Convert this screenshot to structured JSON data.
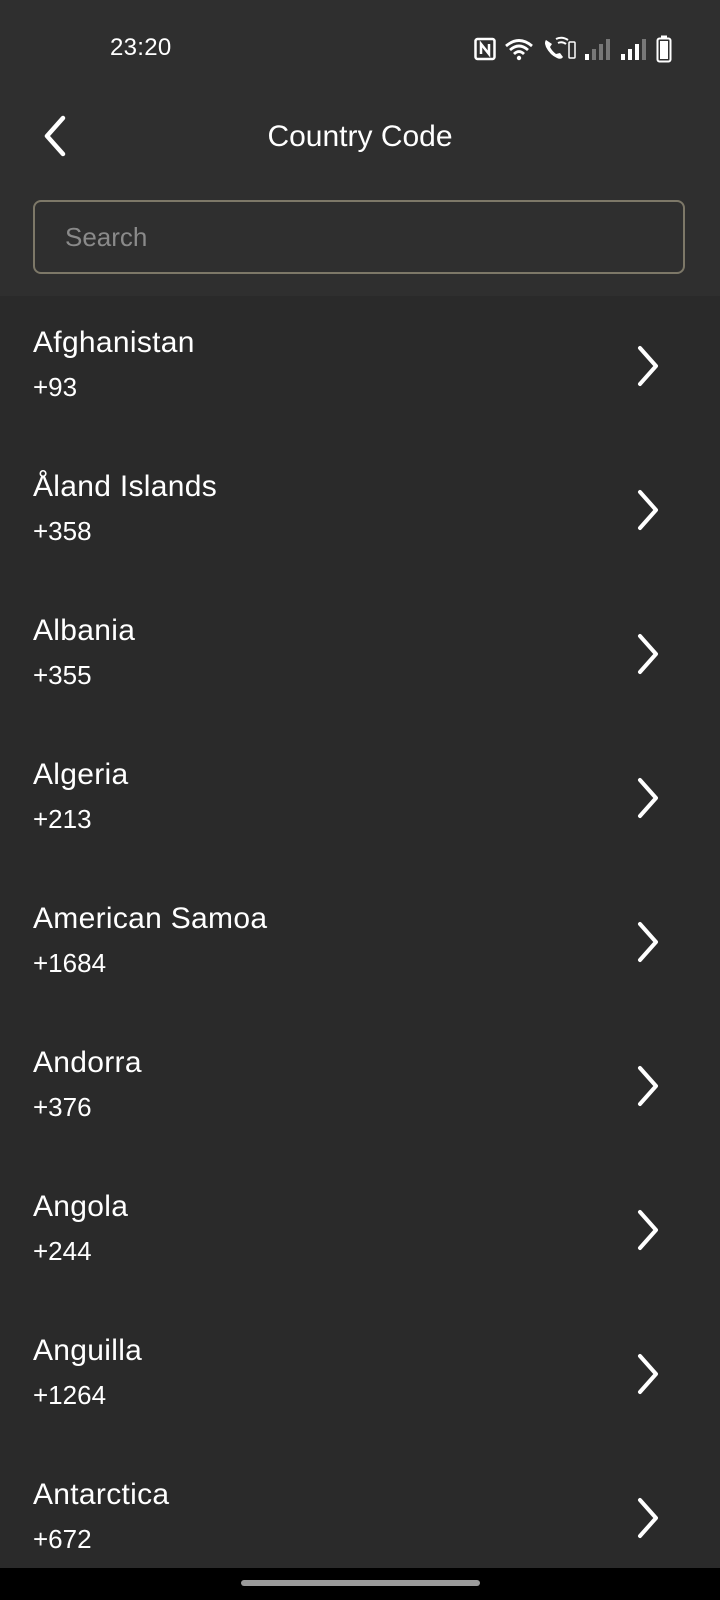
{
  "status_bar": {
    "time": "23:20",
    "icons": [
      "nfc-icon",
      "wifi-icon",
      "wifi-calling-icon",
      "signal-icon",
      "signal-icon",
      "battery-icon"
    ]
  },
  "header": {
    "title": "Country Code",
    "back_icon": "chevron-left-icon"
  },
  "search": {
    "placeholder": "Search",
    "value": ""
  },
  "countries": [
    {
      "name": "Afghanistan",
      "code": "+93"
    },
    {
      "name": "Åland Islands",
      "code": "+358"
    },
    {
      "name": "Albania",
      "code": "+355"
    },
    {
      "name": "Algeria",
      "code": "+213"
    },
    {
      "name": "American Samoa",
      "code": "+1684"
    },
    {
      "name": "Andorra",
      "code": "+376"
    },
    {
      "name": "Angola",
      "code": "+244"
    },
    {
      "name": "Anguilla",
      "code": "+1264"
    },
    {
      "name": "Antarctica",
      "code": "+672"
    }
  ],
  "colors": {
    "background": "#2a2a2a",
    "header_background": "#2f2f2f",
    "search_border": "#7d7868",
    "text": "#ffffff",
    "placeholder": "#8a8a8a"
  }
}
